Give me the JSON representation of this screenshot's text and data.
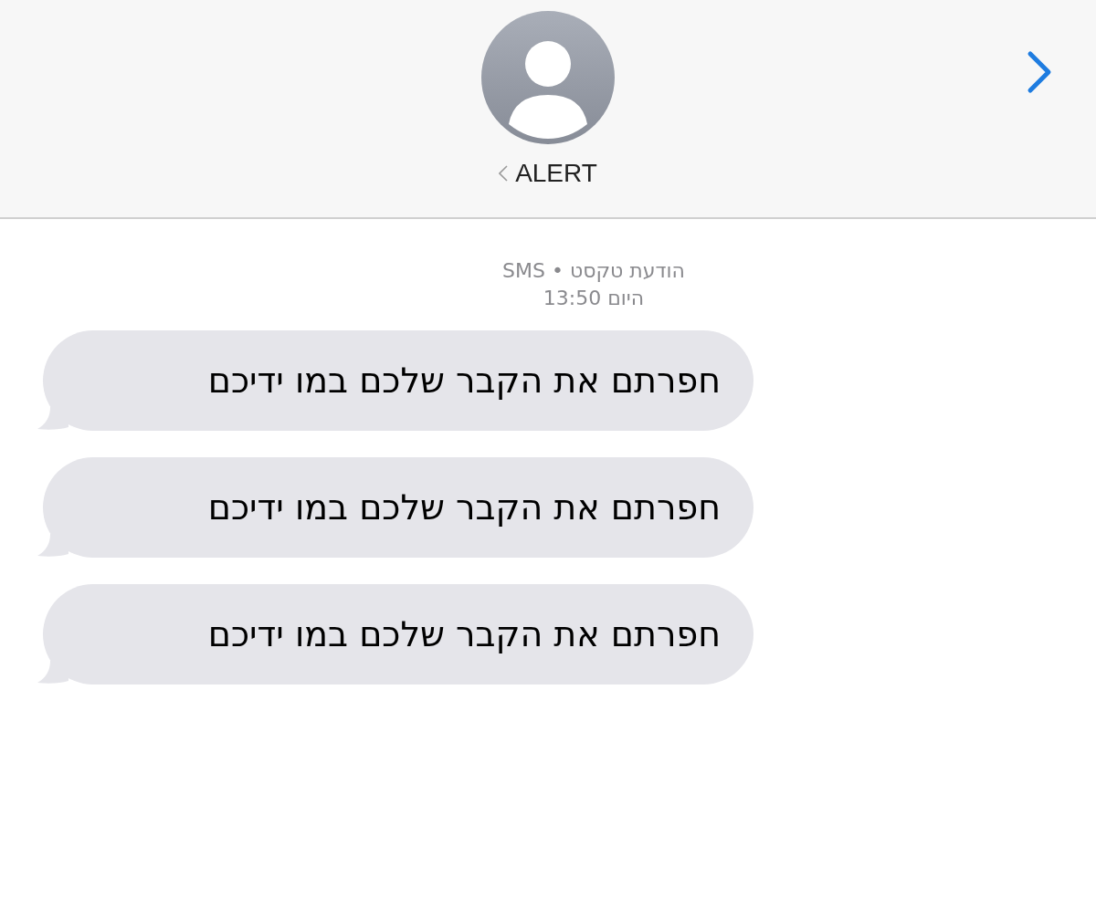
{
  "header": {
    "contact_name": "ALERT"
  },
  "meta": {
    "service": "הודעת טקסט • SMS",
    "time": "היום 13:50"
  },
  "messages": [
    {
      "text": "חפרתם את הקבר שלכם במו ידיכם"
    },
    {
      "text": "חפרתם את הקבר שלכם במו ידיכם"
    },
    {
      "text": "חפרתם את הקבר שלכם במו ידיכם"
    }
  ]
}
